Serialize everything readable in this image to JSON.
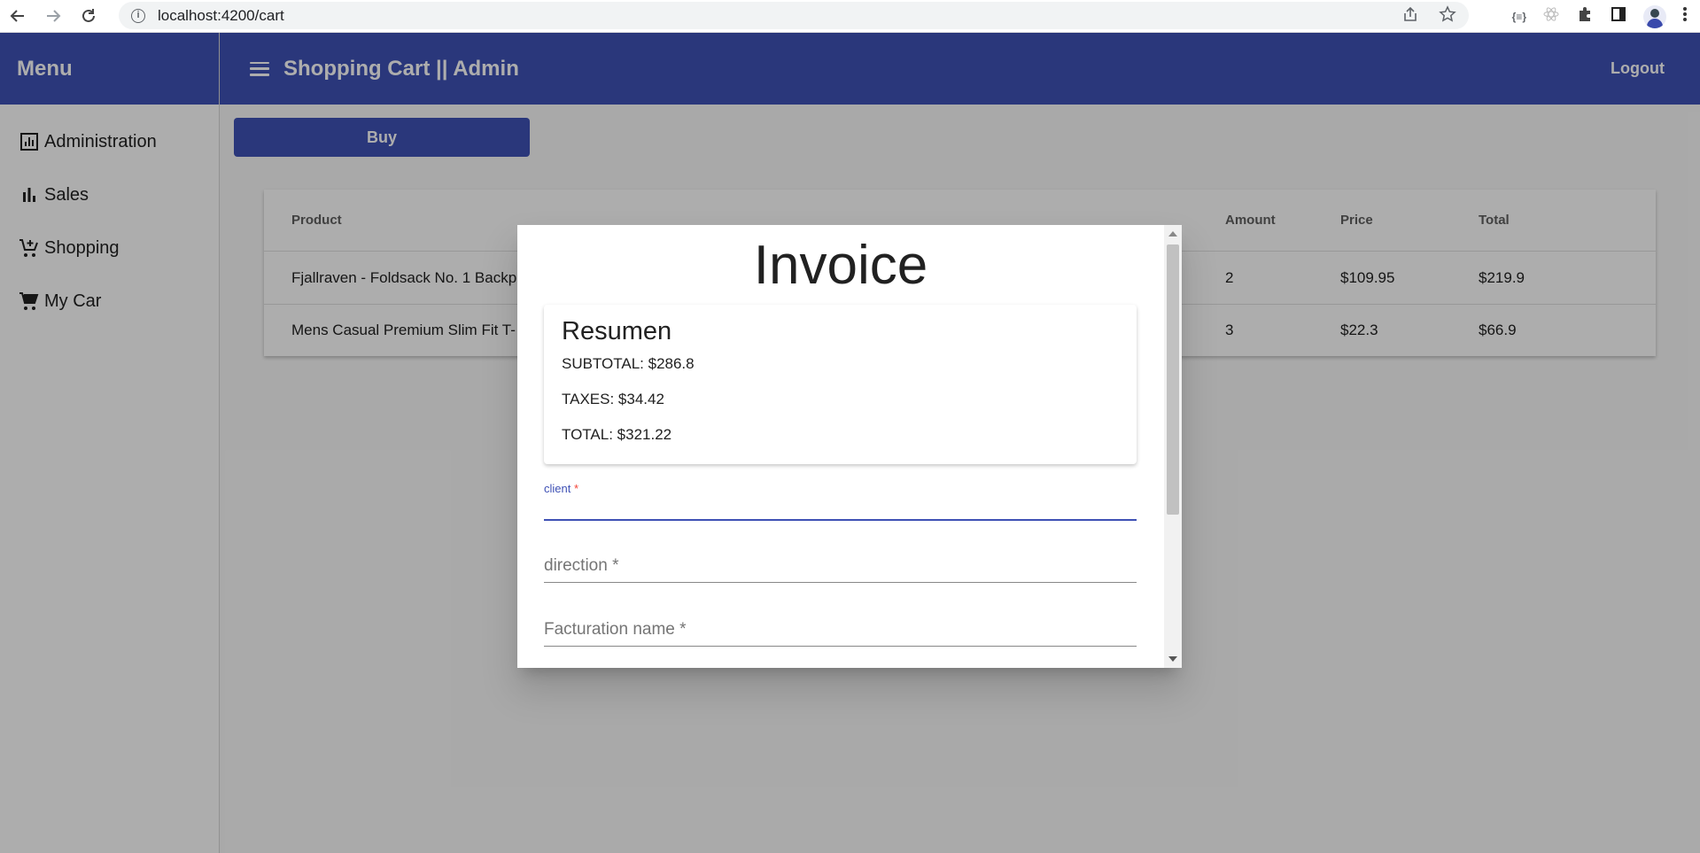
{
  "browser": {
    "url": "localhost:4200/cart"
  },
  "sidebar": {
    "title": "Menu",
    "items": [
      {
        "label": "Administration",
        "icon": "analytics-icon"
      },
      {
        "label": "Sales",
        "icon": "bar-chart-icon"
      },
      {
        "label": "Shopping",
        "icon": "add-shopping-cart-icon"
      },
      {
        "label": "My Car",
        "icon": "shopping-cart-icon"
      }
    ]
  },
  "toolbar": {
    "title": "Shopping Cart || Admin",
    "logout_label": "Logout"
  },
  "main": {
    "buy_label": "Buy",
    "table": {
      "headers": {
        "product": "Product",
        "amount": "Amount",
        "price": "Price",
        "total": "Total"
      },
      "rows": [
        {
          "product": "Fjallraven - Foldsack No. 1 Backp",
          "amount": "2",
          "price": "$109.95",
          "total": "$219.9"
        },
        {
          "product": "Mens Casual Premium Slim Fit T-",
          "amount": "3",
          "price": "$22.3",
          "total": "$66.9"
        }
      ]
    }
  },
  "dialog": {
    "title": "Invoice",
    "summary": {
      "title": "Resumen",
      "subtotal": "SUBTOTAL: $286.8",
      "taxes": "TAXES: $34.42",
      "total": "TOTAL: $321.22"
    },
    "fields": {
      "client_label": "client",
      "required_mark": "*",
      "direction_label": "direction *",
      "facturation_label": "Facturation name *"
    }
  },
  "colors": {
    "primary": "#3f51b5",
    "warn": "#f44336"
  }
}
